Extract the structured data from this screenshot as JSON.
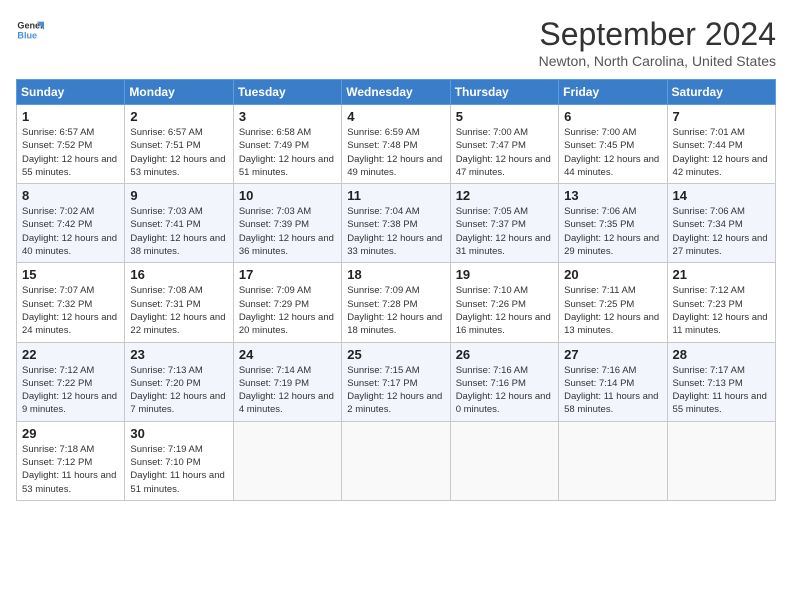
{
  "logo": {
    "line1": "General",
    "line2": "Blue"
  },
  "title": "September 2024",
  "location": "Newton, North Carolina, United States",
  "days_header": [
    "Sunday",
    "Monday",
    "Tuesday",
    "Wednesday",
    "Thursday",
    "Friday",
    "Saturday"
  ],
  "weeks": [
    [
      {
        "num": "1",
        "rise": "6:57 AM",
        "set": "7:52 PM",
        "daylight": "12 hours and 55 minutes."
      },
      {
        "num": "2",
        "rise": "6:57 AM",
        "set": "7:51 PM",
        "daylight": "12 hours and 53 minutes."
      },
      {
        "num": "3",
        "rise": "6:58 AM",
        "set": "7:49 PM",
        "daylight": "12 hours and 51 minutes."
      },
      {
        "num": "4",
        "rise": "6:59 AM",
        "set": "7:48 PM",
        "daylight": "12 hours and 49 minutes."
      },
      {
        "num": "5",
        "rise": "7:00 AM",
        "set": "7:47 PM",
        "daylight": "12 hours and 47 minutes."
      },
      {
        "num": "6",
        "rise": "7:00 AM",
        "set": "7:45 PM",
        "daylight": "12 hours and 44 minutes."
      },
      {
        "num": "7",
        "rise": "7:01 AM",
        "set": "7:44 PM",
        "daylight": "12 hours and 42 minutes."
      }
    ],
    [
      {
        "num": "8",
        "rise": "7:02 AM",
        "set": "7:42 PM",
        "daylight": "12 hours and 40 minutes."
      },
      {
        "num": "9",
        "rise": "7:03 AM",
        "set": "7:41 PM",
        "daylight": "12 hours and 38 minutes."
      },
      {
        "num": "10",
        "rise": "7:03 AM",
        "set": "7:39 PM",
        "daylight": "12 hours and 36 minutes."
      },
      {
        "num": "11",
        "rise": "7:04 AM",
        "set": "7:38 PM",
        "daylight": "12 hours and 33 minutes."
      },
      {
        "num": "12",
        "rise": "7:05 AM",
        "set": "7:37 PM",
        "daylight": "12 hours and 31 minutes."
      },
      {
        "num": "13",
        "rise": "7:06 AM",
        "set": "7:35 PM",
        "daylight": "12 hours and 29 minutes."
      },
      {
        "num": "14",
        "rise": "7:06 AM",
        "set": "7:34 PM",
        "daylight": "12 hours and 27 minutes."
      }
    ],
    [
      {
        "num": "15",
        "rise": "7:07 AM",
        "set": "7:32 PM",
        "daylight": "12 hours and 24 minutes."
      },
      {
        "num": "16",
        "rise": "7:08 AM",
        "set": "7:31 PM",
        "daylight": "12 hours and 22 minutes."
      },
      {
        "num": "17",
        "rise": "7:09 AM",
        "set": "7:29 PM",
        "daylight": "12 hours and 20 minutes."
      },
      {
        "num": "18",
        "rise": "7:09 AM",
        "set": "7:28 PM",
        "daylight": "12 hours and 18 minutes."
      },
      {
        "num": "19",
        "rise": "7:10 AM",
        "set": "7:26 PM",
        "daylight": "12 hours and 16 minutes."
      },
      {
        "num": "20",
        "rise": "7:11 AM",
        "set": "7:25 PM",
        "daylight": "12 hours and 13 minutes."
      },
      {
        "num": "21",
        "rise": "7:12 AM",
        "set": "7:23 PM",
        "daylight": "12 hours and 11 minutes."
      }
    ],
    [
      {
        "num": "22",
        "rise": "7:12 AM",
        "set": "7:22 PM",
        "daylight": "12 hours and 9 minutes."
      },
      {
        "num": "23",
        "rise": "7:13 AM",
        "set": "7:20 PM",
        "daylight": "12 hours and 7 minutes."
      },
      {
        "num": "24",
        "rise": "7:14 AM",
        "set": "7:19 PM",
        "daylight": "12 hours and 4 minutes."
      },
      {
        "num": "25",
        "rise": "7:15 AM",
        "set": "7:17 PM",
        "daylight": "12 hours and 2 minutes."
      },
      {
        "num": "26",
        "rise": "7:16 AM",
        "set": "7:16 PM",
        "daylight": "12 hours and 0 minutes."
      },
      {
        "num": "27",
        "rise": "7:16 AM",
        "set": "7:14 PM",
        "daylight": "11 hours and 58 minutes."
      },
      {
        "num": "28",
        "rise": "7:17 AM",
        "set": "7:13 PM",
        "daylight": "11 hours and 55 minutes."
      }
    ],
    [
      {
        "num": "29",
        "rise": "7:18 AM",
        "set": "7:12 PM",
        "daylight": "11 hours and 53 minutes."
      },
      {
        "num": "30",
        "rise": "7:19 AM",
        "set": "7:10 PM",
        "daylight": "11 hours and 51 minutes."
      },
      null,
      null,
      null,
      null,
      null
    ]
  ]
}
